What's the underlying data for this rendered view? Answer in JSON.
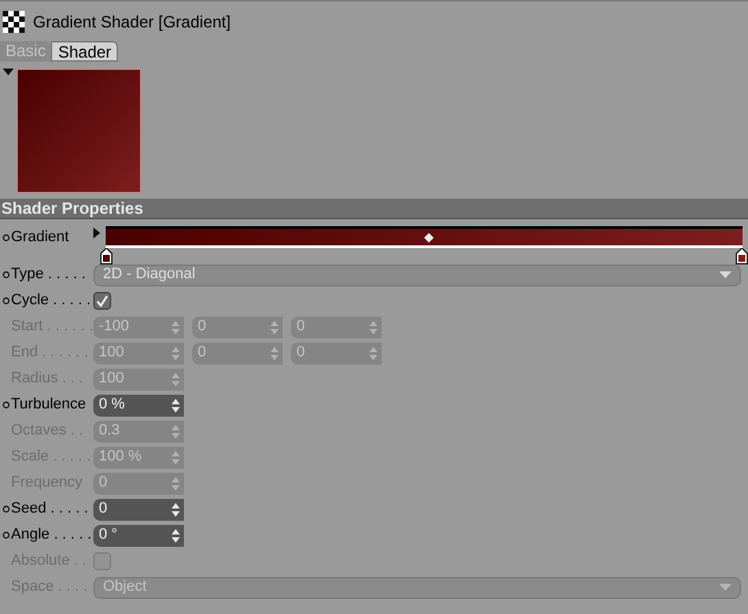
{
  "window": {
    "title": "Gradient Shader [Gradient]"
  },
  "tabs": [
    {
      "label": "Basic",
      "selected": false
    },
    {
      "label": "Shader",
      "selected": true
    }
  ],
  "preview": {
    "expanded": true
  },
  "section": {
    "title": "Shader Properties"
  },
  "rows": [
    {
      "kind": "gradient",
      "label": "Gradient",
      "animatable": true,
      "disabled": false,
      "knots": [
        {
          "color": "#4a0000"
        },
        {
          "color": "#7c1e1e"
        }
      ]
    },
    {
      "kind": "dropdown",
      "label": "Type . . . . .",
      "animatable": true,
      "disabled": false,
      "value": "2D - Diagonal"
    },
    {
      "kind": "checkbox",
      "label": "Cycle . . . . .",
      "animatable": true,
      "disabled": false,
      "checked": true
    },
    {
      "kind": "number",
      "label": "Start . . . . . .",
      "animatable": false,
      "disabled": true,
      "values": [
        "-100",
        "0",
        "0"
      ]
    },
    {
      "kind": "number",
      "label": "End . . . . . .",
      "animatable": false,
      "disabled": true,
      "values": [
        "100",
        "0",
        "0"
      ]
    },
    {
      "kind": "number",
      "label": "Radius . . .",
      "animatable": false,
      "disabled": true,
      "values": [
        "100"
      ]
    },
    {
      "kind": "number",
      "label": "Turbulence",
      "animatable": true,
      "disabled": false,
      "values": [
        "0 %"
      ]
    },
    {
      "kind": "number",
      "label": "Octaves . .",
      "animatable": false,
      "disabled": true,
      "values": [
        "0.3"
      ]
    },
    {
      "kind": "number",
      "label": "Scale . . . . .",
      "animatable": false,
      "disabled": true,
      "values": [
        "100 %"
      ]
    },
    {
      "kind": "number",
      "label": "Frequency",
      "animatable": false,
      "disabled": true,
      "values": [
        "0"
      ]
    },
    {
      "kind": "number",
      "label": "Seed . . . . .",
      "animatable": true,
      "disabled": false,
      "values": [
        "0"
      ]
    },
    {
      "kind": "number",
      "label": "Angle . . . . .",
      "animatable": true,
      "disabled": false,
      "values": [
        "0 °"
      ]
    },
    {
      "kind": "checkbox",
      "label": "Absolute . .",
      "animatable": false,
      "disabled": true,
      "checked": false
    },
    {
      "kind": "dropdown",
      "label": "Space . . . .",
      "animatable": false,
      "disabled": true,
      "value": "Object"
    }
  ]
}
